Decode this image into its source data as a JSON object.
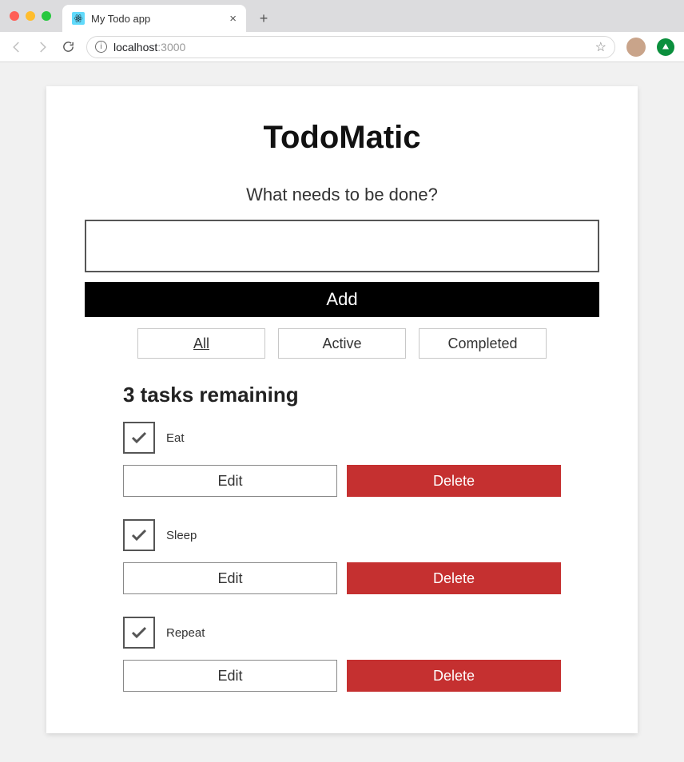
{
  "browser": {
    "tab_title": "My Todo app",
    "url_host": "localhost",
    "url_path": ":3000"
  },
  "app": {
    "title": "TodoMatic",
    "prompt": "What needs to be done?",
    "input_value": "",
    "add_label": "Add",
    "filters": {
      "all": "All",
      "active": "Active",
      "completed": "Completed",
      "selected": "all"
    },
    "heading": "3 tasks remaining",
    "edit_label": "Edit",
    "delete_label": "Delete",
    "tasks": [
      {
        "label": "Eat",
        "completed": true
      },
      {
        "label": "Sleep",
        "completed": true
      },
      {
        "label": "Repeat",
        "completed": true
      }
    ]
  }
}
